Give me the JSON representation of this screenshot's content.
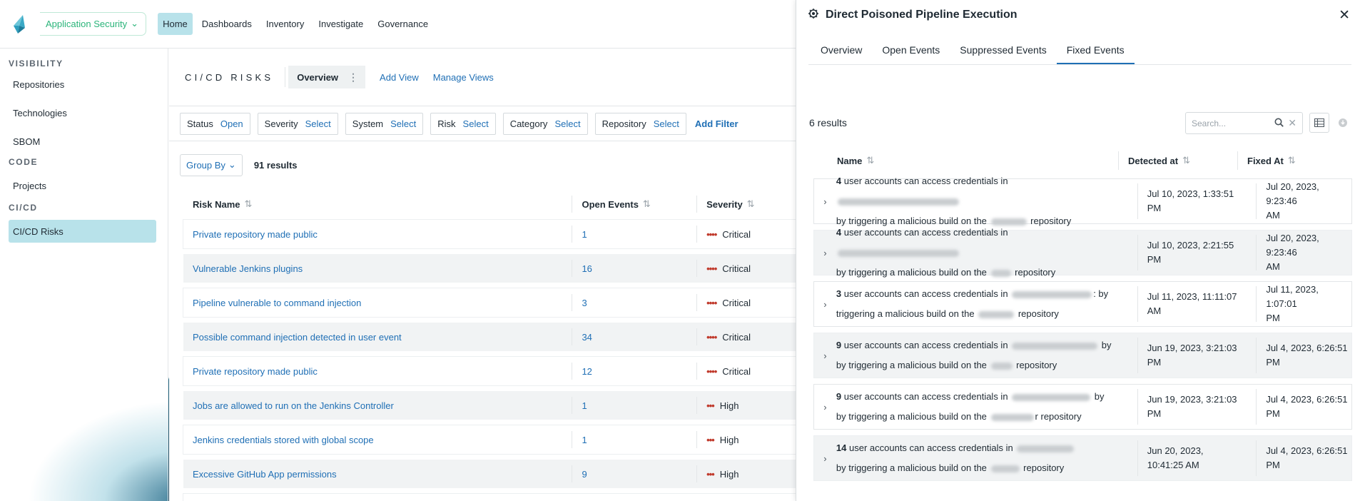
{
  "topbar": {
    "app_switch": "Application Security",
    "nav": [
      "Home",
      "Dashboards",
      "Inventory",
      "Investigate",
      "Governance"
    ]
  },
  "sidebar": {
    "visibility_label": "VISIBILITY",
    "visibility_items": [
      "Repositories",
      "Technologies",
      "SBOM"
    ],
    "code_label": "CODE",
    "code_items": [
      "Projects"
    ],
    "cicd_label": "CI/CD",
    "cicd_items": [
      "CI/CD Risks"
    ]
  },
  "main": {
    "title": "CI/CD RISKS",
    "view_tab": "Overview",
    "add_view": "Add View",
    "manage_views": "Manage Views",
    "filters": [
      {
        "label": "Status",
        "value": "Open"
      },
      {
        "label": "Severity",
        "value": "Select"
      },
      {
        "label": "System",
        "value": "Select"
      },
      {
        "label": "Risk",
        "value": "Select"
      },
      {
        "label": "Category",
        "value": "Select"
      },
      {
        "label": "Repository",
        "value": "Select"
      }
    ],
    "add_filter": "Add Filter",
    "group_by": "Group By",
    "results": "91 results",
    "columns": [
      "Risk Name",
      "Open Events",
      "Severity"
    ],
    "rows": [
      {
        "name": "Private repository made public",
        "events": "1",
        "severity": "Critical",
        "dots": "••••"
      },
      {
        "name": "Vulnerable Jenkins plugins",
        "events": "16",
        "severity": "Critical",
        "dots": "••••"
      },
      {
        "name": "Pipeline vulnerable to command injection",
        "events": "3",
        "severity": "Critical",
        "dots": "••••"
      },
      {
        "name": "Possible command injection detected in user event",
        "events": "34",
        "severity": "Critical",
        "dots": "••••"
      },
      {
        "name": "Private repository made public",
        "events": "12",
        "severity": "Critical",
        "dots": "••••"
      },
      {
        "name": "Jobs are allowed to run on the Jenkins Controller",
        "events": "1",
        "severity": "High",
        "dots": "•••"
      },
      {
        "name": "Jenkins credentials stored with global scope",
        "events": "1",
        "severity": "High",
        "dots": "•••"
      },
      {
        "name": "Excessive GitHub App permissions",
        "events": "9",
        "severity": "High",
        "dots": "•••"
      }
    ]
  },
  "panel": {
    "title": "Direct Poisoned Pipeline Execution",
    "tabs": [
      "Overview",
      "Open Events",
      "Suppressed Events",
      "Fixed Events"
    ],
    "results": "6 results",
    "search_placeholder": "Search...",
    "columns": [
      "Name",
      "Detected at",
      "Fixed At"
    ],
    "rows": [
      {
        "count": "4",
        "pre": "user accounts can access credentials in",
        "mid": "by triggering a malicious build on the",
        "post": "repository",
        "detected_1": "Jul 10, 2023, 1:33:51",
        "detected_2": "PM",
        "fixed_1": "Jul 20, 2023, 9:23:46",
        "fixed_2": "AM"
      },
      {
        "count": "4",
        "pre": "user accounts can access credentials in",
        "mid": "by triggering a malicious build on the",
        "post": "repository",
        "detected_1": "Jul 10, 2023, 2:21:55",
        "detected_2": "PM",
        "fixed_1": "Jul 20, 2023, 9:23:46",
        "fixed_2": "AM"
      },
      {
        "count": "3",
        "pre": "user accounts can access credentials in",
        "mid": ": by triggering a malicious build on the",
        "post": "repository",
        "detected_1": "Jul 11, 2023, 11:11:07",
        "detected_2": "AM",
        "fixed_1": "Jul 11, 2023, 1:07:01",
        "fixed_2": "PM"
      },
      {
        "count": "9",
        "pre": "user accounts can access credentials in",
        "mid": "by triggering a malicious build on the",
        "post": "repository",
        "detected_1": "Jun 19, 2023, 3:21:03",
        "detected_2": "PM",
        "fixed_1": "Jul 4, 2023, 6:26:51",
        "fixed_2": "PM"
      },
      {
        "count": "9",
        "pre": "user accounts can access credentials in",
        "mid": "by triggering a malicious build on the",
        "post": "r repository",
        "detected_1": "Jun 19, 2023, 3:21:03",
        "detected_2": "PM",
        "fixed_1": "Jul 4, 2023, 6:26:51",
        "fixed_2": "PM"
      },
      {
        "count": "14",
        "pre": "user accounts can access credentials in",
        "mid": "by triggering a malicious build on the",
        "post": "repository",
        "detected_1": "Jun 20, 2023,",
        "detected_2": "10:41:25 AM",
        "fixed_1": "Jul 4, 2023, 6:26:51",
        "fixed_2": "PM"
      }
    ]
  },
  "colors": {
    "accent": "#1f6fb5",
    "active_nav": "#b8e2ea",
    "critical": "#c0392b",
    "app_green": "#2bb47a"
  }
}
